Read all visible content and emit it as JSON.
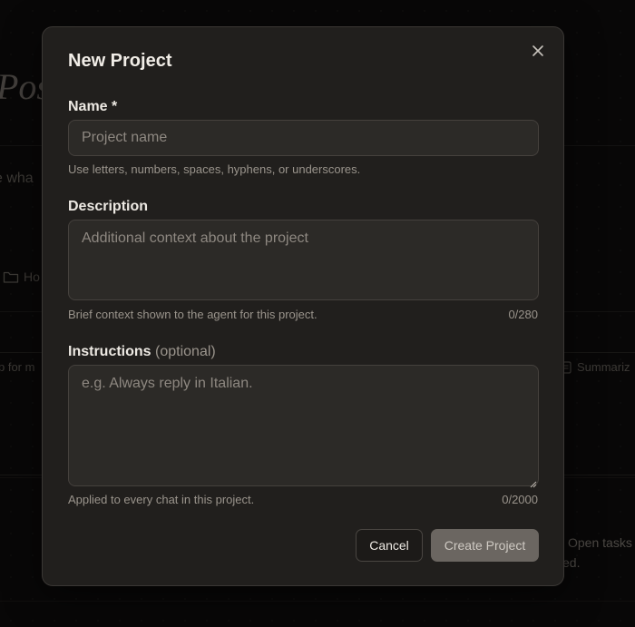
{
  "background": {
    "page_title": "Pos",
    "prompt_hint": "e wha",
    "folder_label": "Ho",
    "chip_left": "p for m",
    "chip_right": "Summariz",
    "card_text_1": "Open tasks",
    "card_text_2": "ed."
  },
  "modal": {
    "title": "New Project",
    "name": {
      "label": "Name *",
      "placeholder": "Project name",
      "helper": "Use letters, numbers, spaces, hyphens, or underscores."
    },
    "description": {
      "label": "Description",
      "placeholder": "Additional context about the project",
      "helper": "Brief context shown to the agent for this project.",
      "counter": "0/280"
    },
    "instructions": {
      "label": "Instructions",
      "optional": "(optional)",
      "placeholder": "e.g. Always reply in Italian.",
      "helper": "Applied to every chat in this project.",
      "counter": "0/2000"
    },
    "buttons": {
      "cancel": "Cancel",
      "create": "Create Project"
    }
  },
  "icons": {
    "close": "close-icon",
    "folder": "folder-icon",
    "document": "document-icon",
    "resize": "resize-grip-icon"
  },
  "colors": {
    "modal_bg": "#211f1d",
    "input_bg": "#2c2a27",
    "create_button_bg": "#6b6661",
    "page_bg": "#0f0e0d"
  }
}
